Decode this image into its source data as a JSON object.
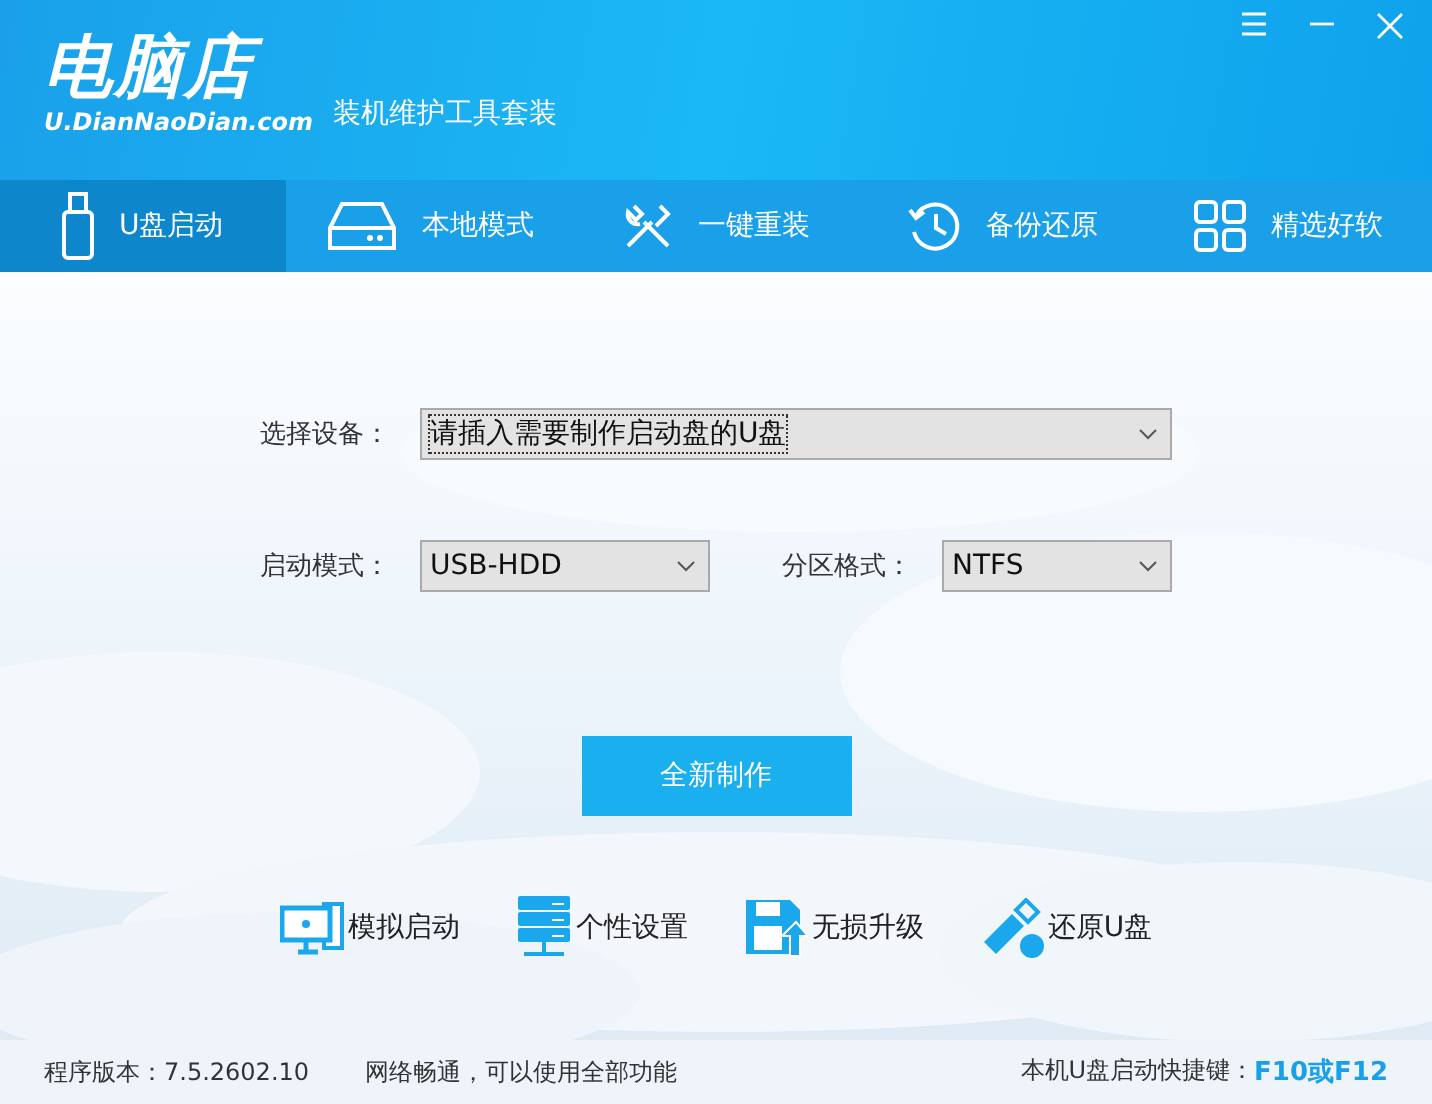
{
  "window": {
    "logo": "电脑店",
    "logo_url": "U.DianNaoDian.com",
    "subtitle": "装机维护工具套装",
    "controls": [
      {
        "kind": "menu"
      },
      {
        "kind": "minimize"
      },
      {
        "kind": "close"
      }
    ]
  },
  "tabs": [
    {
      "label": "U盘启动",
      "kind": "usb",
      "selected": true
    },
    {
      "label": "本地模式",
      "kind": "disk",
      "selected": false
    },
    {
      "label": "一键重装",
      "kind": "tools",
      "selected": false
    },
    {
      "label": "备份还原",
      "kind": "history",
      "selected": false
    },
    {
      "label": "精选好软",
      "kind": "apps",
      "selected": false
    }
  ],
  "form": {
    "device": {
      "label": "选择设备：",
      "value": "请插入需要制作启动盘的U盘"
    },
    "boot_mode": {
      "label": "启动模式：",
      "value": "USB-HDD"
    },
    "partition": {
      "label": "分区格式：",
      "value": "NTFS"
    },
    "button": "全新制作"
  },
  "tools": [
    {
      "label": "模拟启动",
      "kind": "monitor"
    },
    {
      "label": "个性设置",
      "kind": "server"
    },
    {
      "label": "无损升级",
      "kind": "floppy"
    },
    {
      "label": "还原U盘",
      "kind": "usbstick"
    }
  ],
  "status_bar": {
    "version": "程序版本：7.5.2602.10",
    "network": "网络畅通，可以使用全部功能",
    "hotkey_label": "本机U盘启动快捷键：",
    "hotkey": "F10或F12"
  }
}
